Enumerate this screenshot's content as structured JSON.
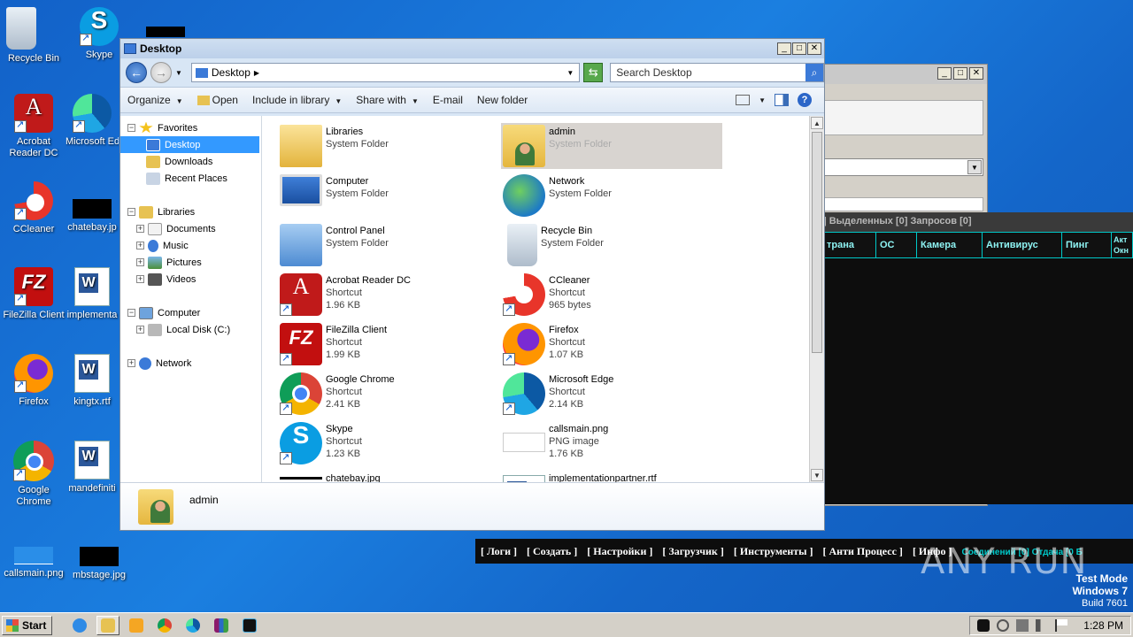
{
  "desktop": {
    "icons": [
      {
        "label": "Recycle Bin"
      },
      {
        "label": "Skype"
      },
      {
        "label": "Acrobat Reader DC"
      },
      {
        "label": "Microsoft Ed"
      },
      {
        "label": "CCleaner"
      },
      {
        "label": "chatebay.jp"
      },
      {
        "label": "FileZilla Client"
      },
      {
        "label": "implementa"
      },
      {
        "label": "Firefox"
      },
      {
        "label": "kingtx.rtf"
      },
      {
        "label": "Google Chrome"
      },
      {
        "label": "mandefiniti"
      },
      {
        "label": "callsmain.png"
      },
      {
        "label": "mbstage.jpg"
      }
    ]
  },
  "bg_app": {
    "header_text": "]  Выделенных [0]  Запросов [0]",
    "columns": [
      "трана",
      "ОС",
      "Камера",
      "Антивирус",
      "Пинг",
      "Акт Окн"
    ],
    "menu": [
      "[ Логи ]",
      "[ Создать ]",
      "[ Настройки ]",
      "[ Загрузчик ]",
      "[ Инструменты ]",
      "[ Анти Процесс ]",
      "[ Инфо ]"
    ],
    "status": "Соединений [0]  Отдача [0 Б"
  },
  "explorer": {
    "title": "Desktop",
    "address": "Desktop",
    "search_placeholder": "Search Desktop",
    "toolbar": {
      "organize": "Organize",
      "open": "Open",
      "include": "Include in library",
      "share": "Share with",
      "email": "E-mail",
      "new_folder": "New folder"
    },
    "nav": {
      "favorites": "Favorites",
      "desktop": "Desktop",
      "downloads": "Downloads",
      "recent": "Recent Places",
      "libraries": "Libraries",
      "documents": "Documents",
      "music": "Music",
      "pictures": "Pictures",
      "videos": "Videos",
      "computer": "Computer",
      "local_disk": "Local Disk (C:)",
      "network": "Network"
    },
    "items": [
      {
        "name": "Libraries",
        "type": "System Folder",
        "size": ""
      },
      {
        "name": "admin",
        "type": "System Folder",
        "size": ""
      },
      {
        "name": "Computer",
        "type": "System Folder",
        "size": ""
      },
      {
        "name": "Network",
        "type": "System Folder",
        "size": ""
      },
      {
        "name": "Control Panel",
        "type": "System Folder",
        "size": ""
      },
      {
        "name": "Recycle Bin",
        "type": "System Folder",
        "size": ""
      },
      {
        "name": "Acrobat Reader DC",
        "type": "Shortcut",
        "size": "1.96 KB"
      },
      {
        "name": "CCleaner",
        "type": "Shortcut",
        "size": "965 bytes"
      },
      {
        "name": "FileZilla Client",
        "type": "Shortcut",
        "size": "1.99 KB"
      },
      {
        "name": "Firefox",
        "type": "Shortcut",
        "size": "1.07 KB"
      },
      {
        "name": "Google Chrome",
        "type": "Shortcut",
        "size": "2.41 KB"
      },
      {
        "name": "Microsoft Edge",
        "type": "Shortcut",
        "size": "2.14 KB"
      },
      {
        "name": "Skype",
        "type": "Shortcut",
        "size": "1.23 KB"
      },
      {
        "name": "callsmain.png",
        "type": "PNG image",
        "size": "1.76 KB"
      },
      {
        "name": "chatebay.jpg",
        "type": "",
        "size": ""
      },
      {
        "name": "implementationpartner.rtf",
        "type": "",
        "size": ""
      }
    ],
    "details_name": "admin"
  },
  "watermark": "ANY RUN",
  "test_mode": {
    "line1": "Test Mode",
    "line2": "Windows 7",
    "line3": "Build 7601"
  },
  "taskbar": {
    "start": "Start",
    "clock": "1:28 PM"
  }
}
